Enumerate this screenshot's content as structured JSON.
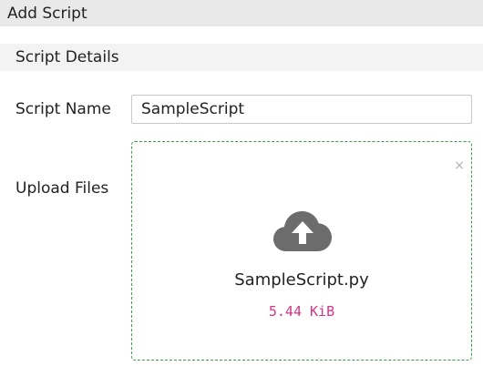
{
  "dialog": {
    "title": "Add Script"
  },
  "section": {
    "title": "Script Details"
  },
  "form": {
    "script_name_label": "Script Name",
    "script_name_value": "SampleScript",
    "upload_label": "Upload Files"
  },
  "upload": {
    "file_name": "SampleScript.py",
    "file_size": "5.44 KiB",
    "remove_glyph": "×",
    "icon": "cloud-upload-icon"
  },
  "colors": {
    "dropzone_border": "#3d9c4d",
    "file_size_text": "#d63384",
    "icon_gray": "#6c6c6c"
  }
}
